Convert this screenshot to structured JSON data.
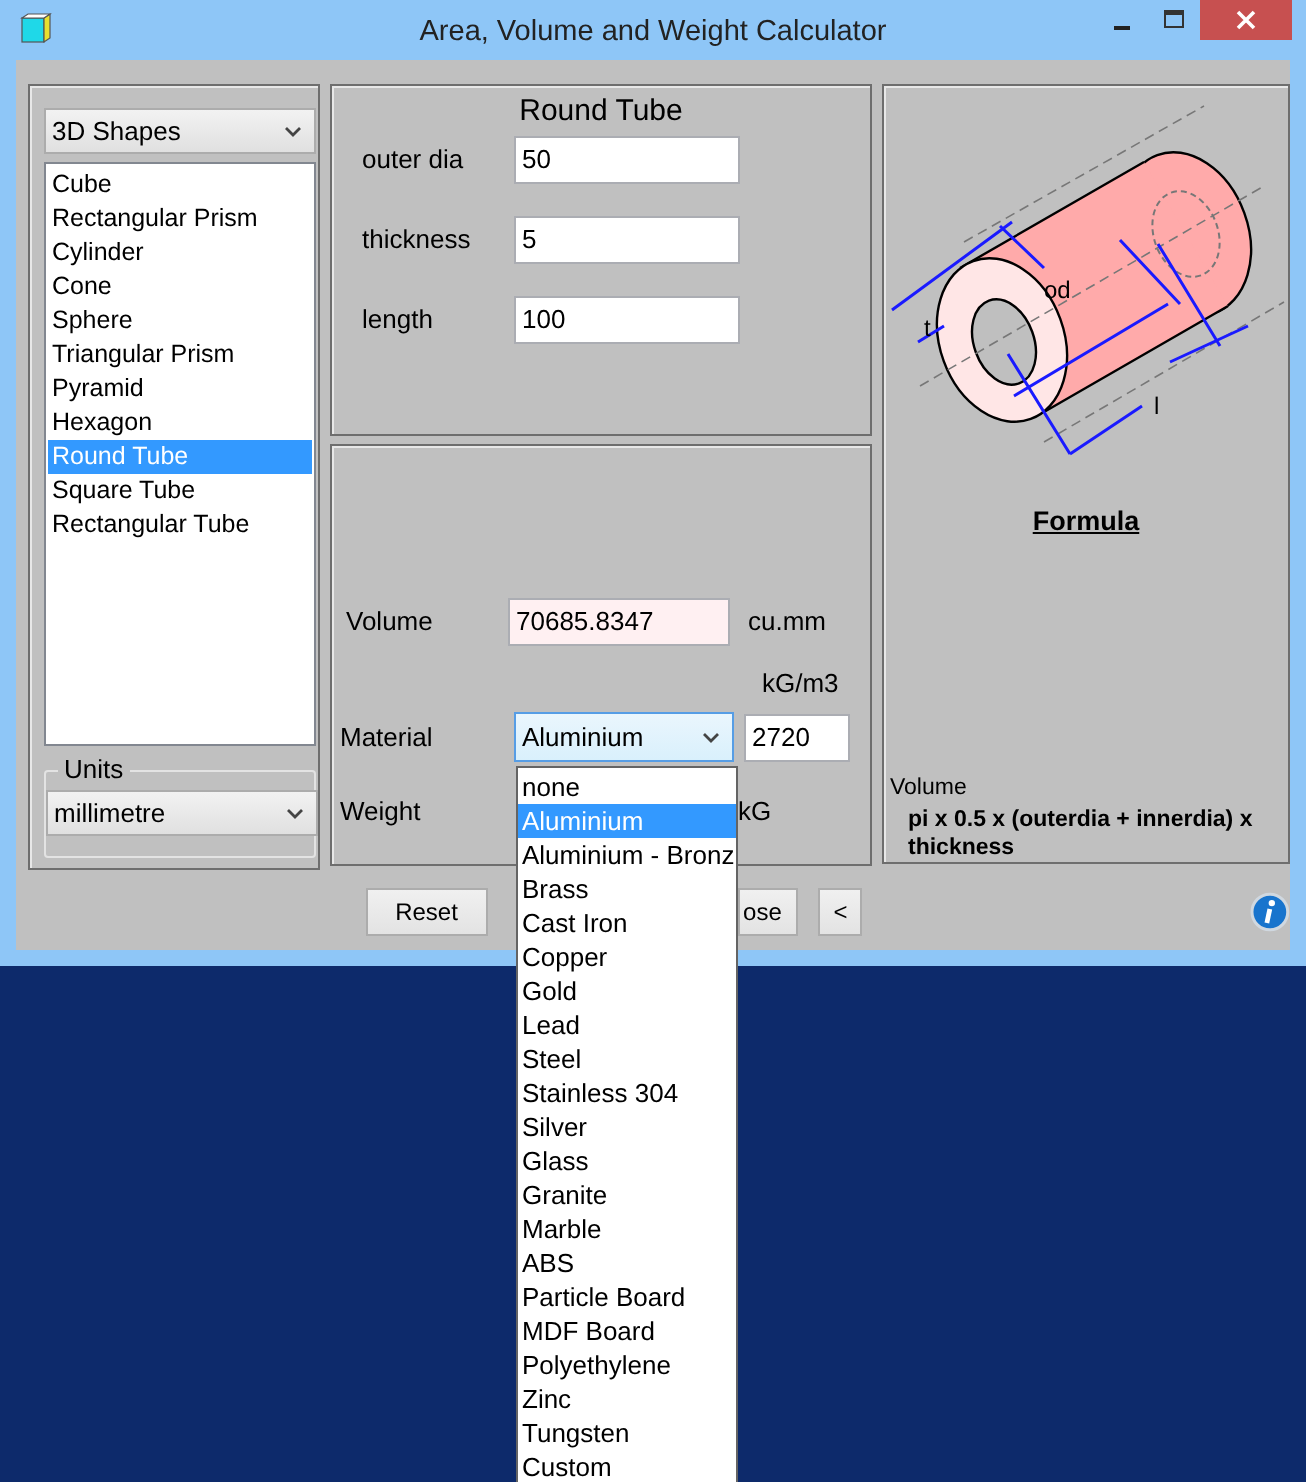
{
  "window": {
    "title": "Area, Volume and Weight Calculator"
  },
  "shape_category": {
    "value": "3D Shapes"
  },
  "shapes": [
    {
      "label": "Cube",
      "selected": false
    },
    {
      "label": "Rectangular Prism",
      "selected": false
    },
    {
      "label": "Cylinder",
      "selected": false
    },
    {
      "label": "Cone",
      "selected": false
    },
    {
      "label": "Sphere",
      "selected": false
    },
    {
      "label": "Triangular Prism",
      "selected": false
    },
    {
      "label": "Pyramid",
      "selected": false
    },
    {
      "label": "Hexagon",
      "selected": false
    },
    {
      "label": "Round Tube",
      "selected": true
    },
    {
      "label": "Square Tube",
      "selected": false
    },
    {
      "label": "Rectangular Tube",
      "selected": false
    }
  ],
  "units": {
    "label": "Units",
    "value": "millimetre"
  },
  "inputs": {
    "title": "Round Tube",
    "fields": [
      {
        "label": "outer dia",
        "value": "50"
      },
      {
        "label": "thickness",
        "value": "5"
      },
      {
        "label": "length",
        "value": "100"
      }
    ]
  },
  "results": {
    "volume": {
      "label": "Volume",
      "value": "70685.8347",
      "unit": "cu.mm"
    },
    "density_unit": "kG/m3",
    "material": {
      "label": "Material",
      "value": "Aluminium",
      "density": "2720"
    },
    "weight": {
      "label": "Weight",
      "unit": "kG"
    }
  },
  "formula": {
    "diagram_labels": [
      "od",
      "t",
      "l"
    ],
    "heading": "Formula",
    "caption": "Volume",
    "text": "pi x 0.5 x (outerdia + innerdia) x thickness"
  },
  "buttons": [
    {
      "label": "Reset"
    },
    {
      "label": "ose"
    },
    {
      "label": "<"
    }
  ],
  "material_options": [
    {
      "label": "none",
      "selected": false
    },
    {
      "label": "Aluminium",
      "selected": true
    },
    {
      "label": "Aluminium - Bronz",
      "selected": false
    },
    {
      "label": "Brass",
      "selected": false
    },
    {
      "label": "Cast Iron",
      "selected": false
    },
    {
      "label": "Copper",
      "selected": false
    },
    {
      "label": "Gold",
      "selected": false
    },
    {
      "label": "Lead",
      "selected": false
    },
    {
      "label": "Steel",
      "selected": false
    },
    {
      "label": "Stainless 304",
      "selected": false
    },
    {
      "label": "Silver",
      "selected": false
    },
    {
      "label": "Glass",
      "selected": false
    },
    {
      "label": "Granite",
      "selected": false
    },
    {
      "label": "Marble",
      "selected": false
    },
    {
      "label": "ABS",
      "selected": false
    },
    {
      "label": "Particle Board",
      "selected": false
    },
    {
      "label": "MDF Board",
      "selected": false
    },
    {
      "label": "Polyethylene",
      "selected": false
    },
    {
      "label": "Zinc",
      "selected": false
    },
    {
      "label": "Tungsten",
      "selected": false
    },
    {
      "label": "Custom",
      "selected": false
    }
  ]
}
